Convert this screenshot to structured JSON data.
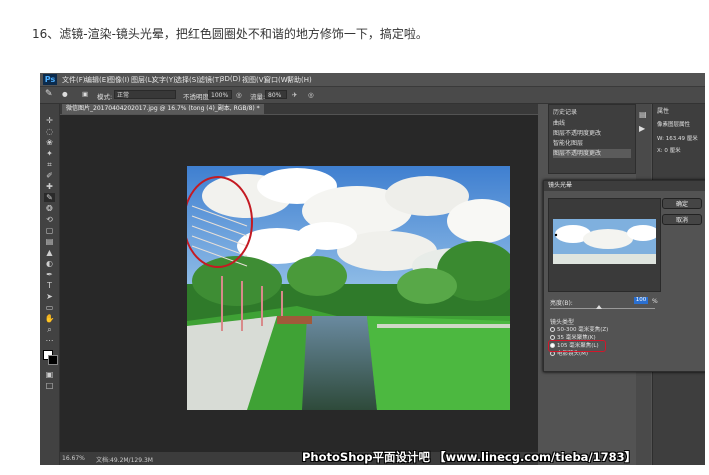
{
  "caption": "16、滤镜-渲染-镜头光晕，把红色圆圈处不和谐的地方修饰一下，搞定啦。",
  "photoshop": {
    "logo": "Ps",
    "menu": [
      "文件(F)",
      "编辑(E)",
      "图像(I)",
      "图层(L)",
      "文字(Y)",
      "选择(S)",
      "滤镜(T)",
      "3D(D)",
      "视图(V)",
      "窗口(W)",
      "帮助(H)"
    ],
    "options": {
      "mode_label": "模式:",
      "mode_value": "正常",
      "opacity_label": "不透明度:",
      "opacity_value": "100%",
      "flow_label": "流量:",
      "flow_value": "80%"
    },
    "document_tab": "微信图片_20170404202017.jpg @ 16.7% (tong (4)_副本, RGB/8) *",
    "history_panel": {
      "title": "历史记录",
      "items": [
        "曲线",
        "图层不透明度更改",
        "智能化图层",
        "图层不透明度更改"
      ]
    },
    "properties_panel": {
      "title": "属性",
      "label": "像素图层属性",
      "w": "W: 163.49 厘米",
      "x": "X: 0 厘米"
    },
    "status": {
      "zoom": "16.67%",
      "doc": "文档:49.2M/129.3M"
    },
    "lens_flare_dialog": {
      "title": "镜头光晕",
      "ok": "确定",
      "cancel": "取消",
      "brightness_label": "亮度(B):",
      "brightness_value": "100",
      "brightness_unit": "%",
      "lens_type_label": "镜头类型",
      "lens_types": [
        "50-300 毫米变焦(Z)",
        "35 毫米聚焦(K)",
        "105 毫米聚焦(L)",
        "电影镜头(M)"
      ],
      "selected_index": 2
    }
  },
  "watermark": "PhotoShop平面设计吧 【www.linecg.com/tieba/1783】"
}
